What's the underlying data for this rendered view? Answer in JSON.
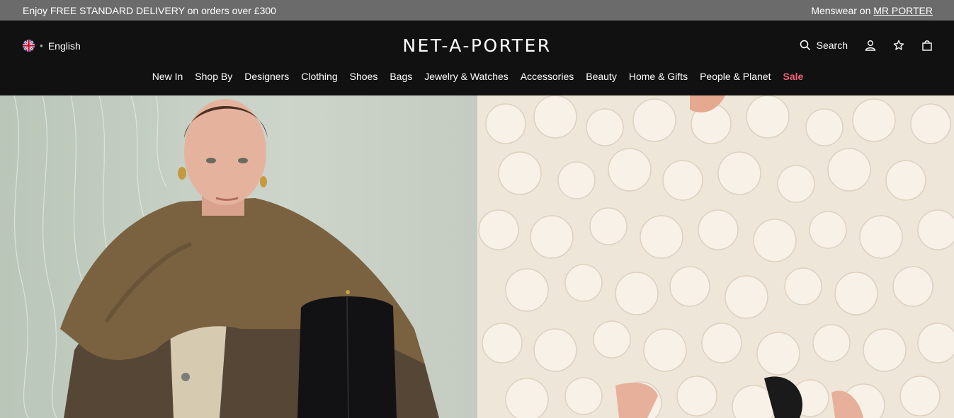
{
  "promo": {
    "left_text": "Enjoy FREE STANDARD DELIVERY on orders over £300",
    "right_prefix": "Menswear on",
    "right_link": "MR PORTER"
  },
  "header": {
    "language": "English",
    "flag_icon": "uk-flag-icon",
    "logo": "NET-A-PORTER",
    "search_label": "Search",
    "icons": [
      "search-icon",
      "account-icon",
      "wishlist-star-icon",
      "shopping-bag-icon"
    ]
  },
  "nav": {
    "items": [
      "New In",
      "Shop By",
      "Designers",
      "Clothing",
      "Shoes",
      "Bags",
      "Jewelry & Watches",
      "Accessories",
      "Beauty",
      "Home & Gifts",
      "People & Planet"
    ],
    "sale": "Sale"
  },
  "colors": {
    "promo_bg": "#6b6b6b",
    "header_bg": "#111111",
    "sale": "#f0627a"
  }
}
